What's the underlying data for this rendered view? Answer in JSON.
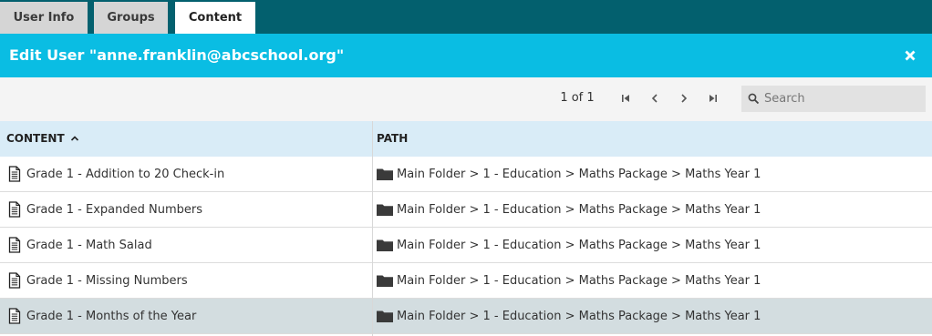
{
  "tabs": [
    {
      "label": "User Info",
      "active": false
    },
    {
      "label": "Groups",
      "active": false
    },
    {
      "label": "Content",
      "active": true
    }
  ],
  "dialog": {
    "title": "Edit User \"anne.franklin@abcschool.org\"",
    "close_icon": "close-icon"
  },
  "pager": {
    "info": "1 of 1",
    "buttons": [
      "first-page-icon",
      "prev-page-icon",
      "next-page-icon",
      "last-page-icon"
    ]
  },
  "search": {
    "placeholder": "Search",
    "value": ""
  },
  "table": {
    "columns": [
      {
        "label": "CONTENT",
        "sort": "ascending"
      },
      {
        "label": "PATH"
      }
    ],
    "rows": [
      {
        "content": "Grade 1 - Addition to 20 Check-in",
        "path": "Main Folder > 1 - Education > Maths Package > Maths Year 1",
        "selected": false
      },
      {
        "content": "Grade 1 - Expanded Numbers",
        "path": "Main Folder > 1 - Education > Maths Package > Maths Year 1",
        "selected": false
      },
      {
        "content": "Grade 1 - Math Salad",
        "path": "Main Folder > 1 - Education > Maths Package > Maths Year 1",
        "selected": false
      },
      {
        "content": "Grade 1 - Missing Numbers",
        "path": "Main Folder > 1 - Education > Maths Package > Maths Year 1",
        "selected": false
      },
      {
        "content": "Grade 1 - Months of the Year",
        "path": "Main Folder > 1 - Education > Maths Package > Maths Year 1",
        "selected": true
      }
    ]
  },
  "colors": {
    "tabbar": "#03606e",
    "titlebar": "#0abde3",
    "header": "#d9ecf7",
    "selected_row": "#d3dde0"
  }
}
